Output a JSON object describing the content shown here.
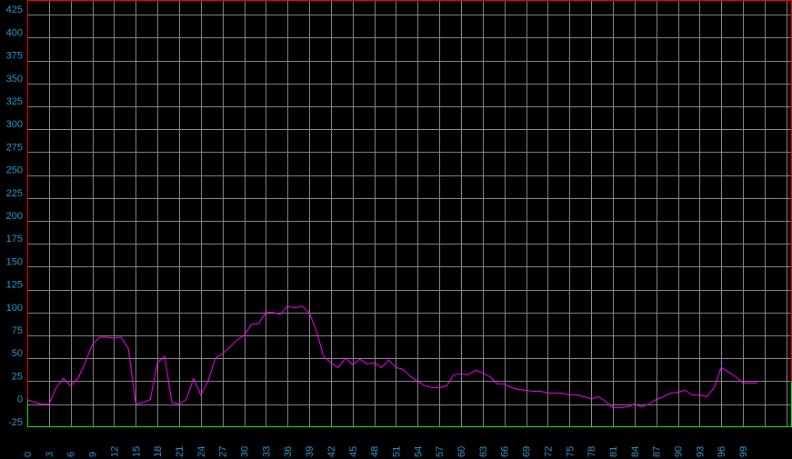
{
  "chart_data": {
    "type": "line",
    "title": "",
    "xlabel": "",
    "ylabel": "",
    "xlim": [
      0,
      101
    ],
    "ylim": [
      -25,
      435
    ],
    "grid": true,
    "x_ticks": [
      0,
      3,
      6,
      9,
      12,
      15,
      18,
      21,
      24,
      27,
      30,
      33,
      36,
      39,
      42,
      45,
      48,
      51,
      54,
      57,
      60,
      63,
      66,
      69,
      72,
      75,
      78,
      81,
      84,
      87,
      90,
      93,
      96,
      99
    ],
    "y_ticks": [
      -25,
      0,
      25,
      50,
      75,
      100,
      125,
      150,
      175,
      200,
      225,
      250,
      275,
      300,
      325,
      350,
      375,
      400,
      425
    ],
    "series": [
      {
        "color": "#ff00ff",
        "x": [
          0,
          1,
          2,
          3,
          4,
          5,
          6,
          7,
          8,
          9,
          10,
          11,
          12,
          13,
          14,
          15,
          16,
          17,
          18,
          19,
          20,
          21,
          22,
          23,
          24,
          25,
          26,
          27,
          28,
          29,
          30,
          31,
          32,
          33,
          34,
          35,
          36,
          37,
          38,
          39,
          40,
          41,
          42,
          43,
          44,
          45,
          46,
          47,
          48,
          49,
          50,
          51,
          52,
          53,
          54,
          55,
          56,
          57,
          58,
          59,
          60,
          61,
          62,
          63,
          64,
          65,
          66,
          67,
          68,
          69,
          70,
          71,
          72,
          73,
          74,
          75,
          76,
          77,
          78,
          79,
          80,
          81,
          82,
          83,
          84,
          85,
          86,
          87,
          88,
          89,
          90,
          91,
          92,
          93,
          94,
          95,
          96,
          97,
          98,
          99,
          100,
          101
        ],
        "values": [
          5,
          2,
          0,
          0,
          18,
          28,
          20,
          28,
          45,
          65,
          73,
          73,
          72,
          73,
          60,
          0,
          2,
          5,
          45,
          52,
          2,
          0,
          5,
          28,
          10,
          25,
          50,
          55,
          62,
          70,
          75,
          87,
          88,
          100,
          100,
          98,
          107,
          105,
          107,
          100,
          80,
          52,
          45,
          40,
          50,
          43,
          49,
          44,
          45,
          40,
          48,
          40,
          38,
          30,
          25,
          20,
          18,
          18,
          20,
          32,
          33,
          32,
          37,
          34,
          30,
          22,
          22,
          18,
          16,
          15,
          14,
          14,
          12,
          12,
          12,
          10,
          10,
          8,
          6,
          8,
          3,
          -4,
          -4,
          -3,
          0,
          -3,
          0,
          5,
          8,
          12,
          13,
          15,
          10,
          10,
          8,
          18,
          40,
          35,
          30,
          23,
          23,
          23
        ]
      }
    ],
    "colors": {
      "background": "#000000",
      "grid": "#8c8c8c",
      "tick_labels": "#2f9bd6",
      "top_border": "#ff0000",
      "bottom_border": "#00ff00",
      "line": "#ff00ff"
    }
  }
}
